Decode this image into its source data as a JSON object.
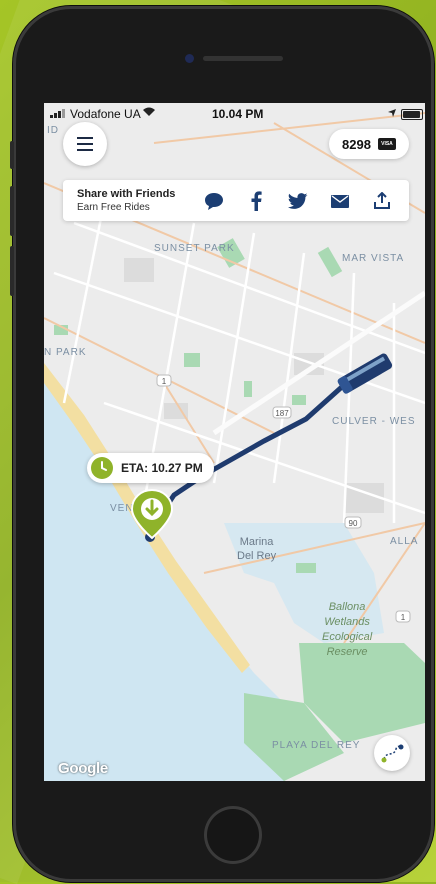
{
  "status_bar": {
    "carrier": "Vodafone UA",
    "time": "10.04 PM"
  },
  "points_pill": {
    "value": "8298",
    "card_brand": "VISA"
  },
  "share_card": {
    "title": "Share with Friends",
    "subtitle": "Earn Free Rides",
    "icons": [
      "chat-bubble-icon",
      "facebook-icon",
      "twitter-icon",
      "mail-icon",
      "share-upload-icon"
    ]
  },
  "eta": {
    "label": "ETA: 10.27 PM"
  },
  "map": {
    "labels": {
      "sunset_park": "SUNSET PARK",
      "mar_vista": "MAR VISTA",
      "park_partial": "N PARK",
      "culver": "CULVER - WES",
      "venice_partial": "VEN",
      "alla_partial": "ALLA",
      "marina_line1": "Marina",
      "marina_line2": "Del Rey",
      "ballona_line1": "Ballona",
      "ballona_line2": "Wetlands",
      "ballona_line3": "Ecological",
      "ballona_line4": "Reserve",
      "playa": "PLAYA DEL REY",
      "id_partial": "ID"
    },
    "road_shields": [
      "1",
      "187",
      "90",
      "1"
    ],
    "colors": {
      "water": "#cfe6f2",
      "beach": "#f3dfa2",
      "park": "#a9d9b3",
      "route": "#1f3b6e",
      "accent": "#8fb32a"
    }
  },
  "attribution": "Google"
}
